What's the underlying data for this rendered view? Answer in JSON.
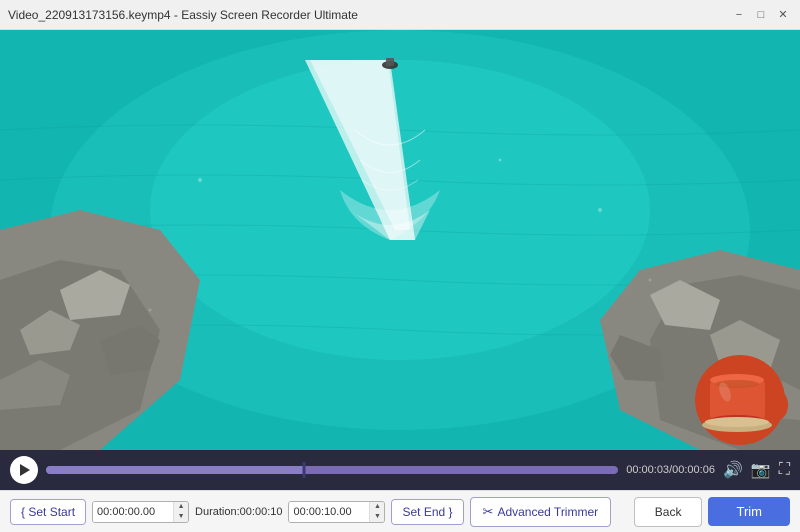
{
  "titlebar": {
    "title": "Video_220913173156.keymp4  -  Eassiy Screen Recorder Ultimate",
    "minimize_label": "−",
    "maximize_label": "□",
    "close_label": "✕"
  },
  "controls": {
    "time_current": "00:00:03",
    "time_total": "00:00:06",
    "volume_icon": "🔊",
    "screenshot_icon": "📷",
    "fullscreen_icon": "⛶"
  },
  "toolbar": {
    "set_start_label": "{ Set Start",
    "start_time_value": "00:00:00.00",
    "duration_label": "Duration:00:00:10",
    "end_time_value": "00:00:10.00",
    "set_end_label": "Set End }",
    "advanced_label": "Advanced Trimmer",
    "back_label": "Back",
    "trim_label": "Trim"
  }
}
